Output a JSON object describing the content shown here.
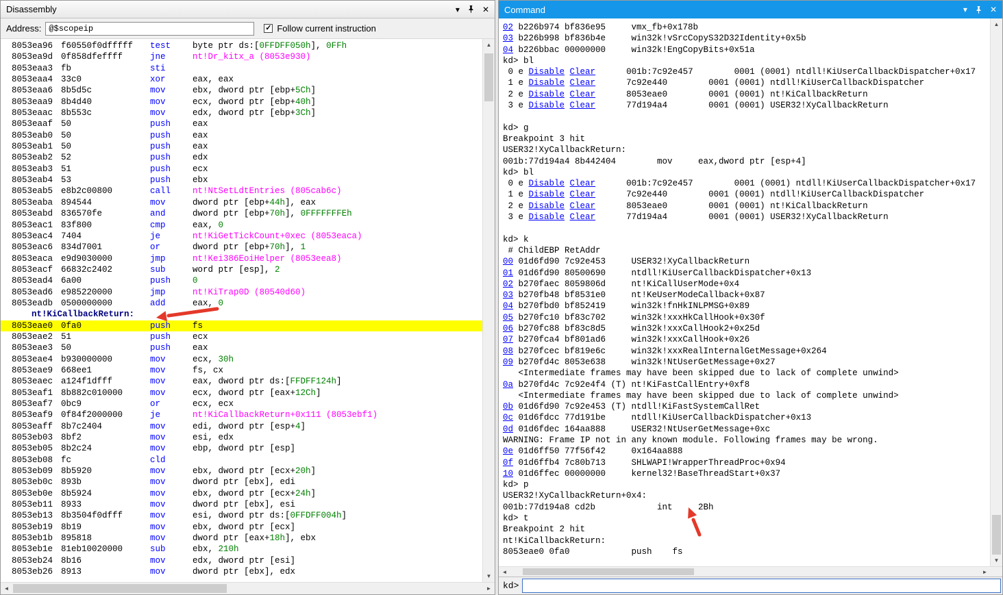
{
  "colors": {
    "command_title_bg": "#1696e8",
    "highlight_bg": "#ffff00",
    "mnemonic": "#0000ff",
    "number_literal": "#008000",
    "symbol_ref": "#ff00ff",
    "link": "#0000ff",
    "label": "#000080",
    "arrow": "#e4392a"
  },
  "icons": {
    "chevron": "▾",
    "close": "✕",
    "scroll_up": "▲",
    "scroll_down": "▼",
    "scroll_left": "◄",
    "scroll_right": "►",
    "check": "✓"
  },
  "disassembly": {
    "title": "Disassembly",
    "address_label": "Address:",
    "address_value": "@$scopeip",
    "follow_label": "Follow current instruction",
    "follow_checked": true,
    "lines": [
      {
        "addr": "8053ea96",
        "bytes": "f60550f0dfffff",
        "mnem": "test",
        "ops": [
          [
            "p",
            "byte ptr ds:["
          ],
          [
            "n",
            "0FFDFF050h"
          ],
          [
            "p",
            "], "
          ],
          [
            "n",
            "0FFh"
          ]
        ]
      },
      {
        "addr": "8053ea9d",
        "bytes": "0f858dfeffff",
        "mnem": "jne",
        "ops": [
          [
            "s",
            "nt!Dr_kitx_a (8053e930)"
          ]
        ]
      },
      {
        "addr": "8053eaa3",
        "bytes": "fb",
        "mnem": "sti",
        "ops": []
      },
      {
        "addr": "8053eaa4",
        "bytes": "33c0",
        "mnem": "xor",
        "ops": [
          [
            "p",
            "eax, eax"
          ]
        ]
      },
      {
        "addr": "8053eaa6",
        "bytes": "8b5d5c",
        "mnem": "mov",
        "ops": [
          [
            "p",
            "ebx, dword ptr [ebp+"
          ],
          [
            "n",
            "5Ch"
          ],
          [
            "p",
            "]"
          ]
        ]
      },
      {
        "addr": "8053eaa9",
        "bytes": "8b4d40",
        "mnem": "mov",
        "ops": [
          [
            "p",
            "ecx, dword ptr [ebp+"
          ],
          [
            "n",
            "40h"
          ],
          [
            "p",
            "]"
          ]
        ]
      },
      {
        "addr": "8053eaac",
        "bytes": "8b553c",
        "mnem": "mov",
        "ops": [
          [
            "p",
            "edx, dword ptr [ebp+"
          ],
          [
            "n",
            "3Ch"
          ],
          [
            "p",
            "]"
          ]
        ]
      },
      {
        "addr": "8053eaaf",
        "bytes": "50",
        "mnem": "push",
        "ops": [
          [
            "p",
            "eax"
          ]
        ]
      },
      {
        "addr": "8053eab0",
        "bytes": "50",
        "mnem": "push",
        "ops": [
          [
            "p",
            "eax"
          ]
        ]
      },
      {
        "addr": "8053eab1",
        "bytes": "50",
        "mnem": "push",
        "ops": [
          [
            "p",
            "eax"
          ]
        ]
      },
      {
        "addr": "8053eab2",
        "bytes": "52",
        "mnem": "push",
        "ops": [
          [
            "p",
            "edx"
          ]
        ]
      },
      {
        "addr": "8053eab3",
        "bytes": "51",
        "mnem": "push",
        "ops": [
          [
            "p",
            "ecx"
          ]
        ]
      },
      {
        "addr": "8053eab4",
        "bytes": "53",
        "mnem": "push",
        "ops": [
          [
            "p",
            "ebx"
          ]
        ]
      },
      {
        "addr": "8053eab5",
        "bytes": "e8b2c00800",
        "mnem": "call",
        "ops": [
          [
            "s",
            "nt!NtSetLdtEntries (805cab6c)"
          ]
        ]
      },
      {
        "addr": "8053eaba",
        "bytes": "894544",
        "mnem": "mov",
        "ops": [
          [
            "p",
            "dword ptr [ebp+"
          ],
          [
            "n",
            "44h"
          ],
          [
            "p",
            "], eax"
          ]
        ]
      },
      {
        "addr": "8053eabd",
        "bytes": "836570fe",
        "mnem": "and",
        "ops": [
          [
            "p",
            "dword ptr [ebp+"
          ],
          [
            "n",
            "70h"
          ],
          [
            "p",
            "], "
          ],
          [
            "n",
            "0FFFFFFFEh"
          ]
        ]
      },
      {
        "addr": "8053eac1",
        "bytes": "83f800",
        "mnem": "cmp",
        "ops": [
          [
            "p",
            "eax, "
          ],
          [
            "n",
            "0"
          ]
        ]
      },
      {
        "addr": "8053eac4",
        "bytes": "7404",
        "mnem": "je",
        "ops": [
          [
            "s",
            "nt!KiGetTickCount+0xec (8053eaca)"
          ]
        ]
      },
      {
        "addr": "8053eac6",
        "bytes": "834d7001",
        "mnem": "or",
        "ops": [
          [
            "p",
            "dword ptr [ebp+"
          ],
          [
            "n",
            "70h"
          ],
          [
            "p",
            "], "
          ],
          [
            "n",
            "1"
          ]
        ]
      },
      {
        "addr": "8053eaca",
        "bytes": "e9d9030000",
        "mnem": "jmp",
        "ops": [
          [
            "s",
            "nt!Kei386EoiHelper (8053eea8)"
          ]
        ]
      },
      {
        "addr": "8053eacf",
        "bytes": "66832c2402",
        "mnem": "sub",
        "ops": [
          [
            "p",
            "word ptr [esp], "
          ],
          [
            "n",
            "2"
          ]
        ]
      },
      {
        "addr": "8053ead4",
        "bytes": "6a00",
        "mnem": "push",
        "ops": [
          [
            "n",
            "0"
          ]
        ]
      },
      {
        "addr": "8053ead6",
        "bytes": "e985220000",
        "mnem": "jmp",
        "ops": [
          [
            "s",
            "nt!KiTrap0D (80540d60)"
          ]
        ]
      },
      {
        "addr": "8053eadb",
        "bytes": "0500000000",
        "mnem": "add",
        "ops": [
          [
            "p",
            "eax, "
          ],
          [
            "n",
            "0"
          ]
        ]
      },
      {
        "label": "nt!KiCallbackReturn:"
      },
      {
        "addr": "8053eae0",
        "bytes": "0fa0",
        "mnem": "push",
        "ops": [
          [
            "p",
            "fs"
          ]
        ],
        "hl": true
      },
      {
        "addr": "8053eae2",
        "bytes": "51",
        "mnem": "push",
        "ops": [
          [
            "p",
            "ecx"
          ]
        ]
      },
      {
        "addr": "8053eae3",
        "bytes": "50",
        "mnem": "push",
        "ops": [
          [
            "p",
            "eax"
          ]
        ]
      },
      {
        "addr": "8053eae4",
        "bytes": "b930000000",
        "mnem": "mov",
        "ops": [
          [
            "p",
            "ecx, "
          ],
          [
            "n",
            "30h"
          ]
        ]
      },
      {
        "addr": "8053eae9",
        "bytes": "668ee1",
        "mnem": "mov",
        "ops": [
          [
            "p",
            "fs, cx"
          ]
        ]
      },
      {
        "addr": "8053eaec",
        "bytes": "a124f1dfff",
        "mnem": "mov",
        "ops": [
          [
            "p",
            "eax, dword ptr ds:["
          ],
          [
            "n",
            "FFDFF124h"
          ],
          [
            "p",
            "]"
          ]
        ]
      },
      {
        "addr": "8053eaf1",
        "bytes": "8b882c010000",
        "mnem": "mov",
        "ops": [
          [
            "p",
            "ecx, dword ptr [eax+"
          ],
          [
            "n",
            "12Ch"
          ],
          [
            "p",
            "]"
          ]
        ]
      },
      {
        "addr": "8053eaf7",
        "bytes": "0bc9",
        "mnem": "or",
        "ops": [
          [
            "p",
            "ecx, ecx"
          ]
        ]
      },
      {
        "addr": "8053eaf9",
        "bytes": "0f84f2000000",
        "mnem": "je",
        "ops": [
          [
            "s",
            "nt!KiCallbackReturn+0x111 (8053ebf1)"
          ]
        ]
      },
      {
        "addr": "8053eaff",
        "bytes": "8b7c2404",
        "mnem": "mov",
        "ops": [
          [
            "p",
            "edi, dword ptr [esp+"
          ],
          [
            "n",
            "4"
          ],
          [
            "p",
            "]"
          ]
        ]
      },
      {
        "addr": "8053eb03",
        "bytes": "8bf2",
        "mnem": "mov",
        "ops": [
          [
            "p",
            "esi, edx"
          ]
        ]
      },
      {
        "addr": "8053eb05",
        "bytes": "8b2c24",
        "mnem": "mov",
        "ops": [
          [
            "p",
            "ebp, dword ptr [esp]"
          ]
        ]
      },
      {
        "addr": "8053eb08",
        "bytes": "fc",
        "mnem": "cld",
        "ops": []
      },
      {
        "addr": "8053eb09",
        "bytes": "8b5920",
        "mnem": "mov",
        "ops": [
          [
            "p",
            "ebx, dword ptr [ecx+"
          ],
          [
            "n",
            "20h"
          ],
          [
            "p",
            "]"
          ]
        ]
      },
      {
        "addr": "8053eb0c",
        "bytes": "893b",
        "mnem": "mov",
        "ops": [
          [
            "p",
            "dword ptr [ebx], edi"
          ]
        ]
      },
      {
        "addr": "8053eb0e",
        "bytes": "8b5924",
        "mnem": "mov",
        "ops": [
          [
            "p",
            "ebx, dword ptr [ecx+"
          ],
          [
            "n",
            "24h"
          ],
          [
            "p",
            "]"
          ]
        ]
      },
      {
        "addr": "8053eb11",
        "bytes": "8933",
        "mnem": "mov",
        "ops": [
          [
            "p",
            "dword ptr [ebx], esi"
          ]
        ]
      },
      {
        "addr": "8053eb13",
        "bytes": "8b3504f0dfff",
        "mnem": "mov",
        "ops": [
          [
            "p",
            "esi, dword ptr ds:["
          ],
          [
            "n",
            "0FFDFF004h"
          ],
          [
            "p",
            "]"
          ]
        ]
      },
      {
        "addr": "8053eb19",
        "bytes": "8b19",
        "mnem": "mov",
        "ops": [
          [
            "p",
            "ebx, dword ptr [ecx]"
          ]
        ]
      },
      {
        "addr": "8053eb1b",
        "bytes": "895818",
        "mnem": "mov",
        "ops": [
          [
            "p",
            "dword ptr [eax+"
          ],
          [
            "n",
            "18h"
          ],
          [
            "p",
            "], ebx"
          ]
        ]
      },
      {
        "addr": "8053eb1e",
        "bytes": "81eb10020000",
        "mnem": "sub",
        "ops": [
          [
            "p",
            "ebx, "
          ],
          [
            "n",
            "210h"
          ]
        ]
      },
      {
        "addr": "8053eb24",
        "bytes": "8b16",
        "mnem": "mov",
        "ops": [
          [
            "p",
            "edx, dword ptr [esi]"
          ]
        ]
      },
      {
        "addr": "8053eb26",
        "bytes": "8913",
        "mnem": "mov",
        "ops": [
          [
            "p",
            "dword ptr [ebx], edx"
          ]
        ]
      }
    ]
  },
  "command": {
    "title": "Command",
    "prompt": "kd>",
    "input_value": "",
    "lines": [
      [
        [
          "l",
          "02"
        ],
        [
          "t",
          " b226b974 bf836e95     vmx_fb+0x178b"
        ]
      ],
      [
        [
          "l",
          "03"
        ],
        [
          "t",
          " b226b998 bf836b4e     win32k!vSrcCopyS32D32Identity+0x5b"
        ]
      ],
      [
        [
          "l",
          "04"
        ],
        [
          "t",
          " b226bbac 00000000     win32k!EngCopyBits+0x51a"
        ]
      ],
      [
        [
          "t",
          "kd> bl"
        ]
      ],
      [
        [
          "t",
          " 0 e "
        ],
        [
          "l",
          "Disable"
        ],
        [
          "t",
          " "
        ],
        [
          "l",
          "Clear"
        ],
        [
          "t",
          "      001b:7c92e457        0001 (0001) ntdll!KiUserCallbackDispatcher+0x17"
        ]
      ],
      [
        [
          "t",
          " 1 e "
        ],
        [
          "l",
          "Disable"
        ],
        [
          "t",
          " "
        ],
        [
          "l",
          "Clear"
        ],
        [
          "t",
          "      7c92e440        0001 (0001) ntdll!KiUserCallbackDispatcher"
        ]
      ],
      [
        [
          "t",
          " 2 e "
        ],
        [
          "l",
          "Disable"
        ],
        [
          "t",
          " "
        ],
        [
          "l",
          "Clear"
        ],
        [
          "t",
          "      8053eae0        0001 (0001) nt!KiCallbackReturn"
        ]
      ],
      [
        [
          "t",
          " 3 e "
        ],
        [
          "l",
          "Disable"
        ],
        [
          "t",
          " "
        ],
        [
          "l",
          "Clear"
        ],
        [
          "t",
          "      77d194a4        0001 (0001) USER32!XyCallbackReturn"
        ]
      ],
      [
        [
          "t",
          ""
        ]
      ],
      [
        [
          "t",
          "kd> g"
        ]
      ],
      [
        [
          "t",
          "Breakpoint 3 hit"
        ]
      ],
      [
        [
          "t",
          "USER32!XyCallbackReturn:"
        ]
      ],
      [
        [
          "t",
          "001b:77d194a4 8b442404        mov     eax,dword ptr [esp+4]"
        ]
      ],
      [
        [
          "t",
          "kd> bl"
        ]
      ],
      [
        [
          "t",
          " 0 e "
        ],
        [
          "l",
          "Disable"
        ],
        [
          "t",
          " "
        ],
        [
          "l",
          "Clear"
        ],
        [
          "t",
          "      001b:7c92e457        0001 (0001) ntdll!KiUserCallbackDispatcher+0x17"
        ]
      ],
      [
        [
          "t",
          " 1 e "
        ],
        [
          "l",
          "Disable"
        ],
        [
          "t",
          " "
        ],
        [
          "l",
          "Clear"
        ],
        [
          "t",
          "      7c92e440        0001 (0001) ntdll!KiUserCallbackDispatcher"
        ]
      ],
      [
        [
          "t",
          " 2 e "
        ],
        [
          "l",
          "Disable"
        ],
        [
          "t",
          " "
        ],
        [
          "l",
          "Clear"
        ],
        [
          "t",
          "      8053eae0        0001 (0001) nt!KiCallbackReturn"
        ]
      ],
      [
        [
          "t",
          " 3 e "
        ],
        [
          "l",
          "Disable"
        ],
        [
          "t",
          " "
        ],
        [
          "l",
          "Clear"
        ],
        [
          "t",
          "      77d194a4        0001 (0001) USER32!XyCallbackReturn"
        ]
      ],
      [
        [
          "t",
          ""
        ]
      ],
      [
        [
          "t",
          "kd> k"
        ]
      ],
      [
        [
          "t",
          " # ChildEBP RetAddr"
        ]
      ],
      [
        [
          "l",
          "00"
        ],
        [
          "t",
          " 01d6fd90 7c92e453     USER32!XyCallbackReturn"
        ]
      ],
      [
        [
          "l",
          "01"
        ],
        [
          "t",
          " 01d6fd90 80500690     ntdll!KiUserCallbackDispatcher+0x13"
        ]
      ],
      [
        [
          "l",
          "02"
        ],
        [
          "t",
          " b270faec 8059806d     nt!KiCallUserMode+0x4"
        ]
      ],
      [
        [
          "l",
          "03"
        ],
        [
          "t",
          " b270fb48 bf8531e0     nt!KeUserModeCallback+0x87"
        ]
      ],
      [
        [
          "l",
          "04"
        ],
        [
          "t",
          " b270fbd0 bf852419     win32k!fnHkINLPMSG+0x89"
        ]
      ],
      [
        [
          "l",
          "05"
        ],
        [
          "t",
          " b270fc10 bf83c702     win32k!xxxHkCallHook+0x30f"
        ]
      ],
      [
        [
          "l",
          "06"
        ],
        [
          "t",
          " b270fc88 bf83c8d5     win32k!xxxCallHook2+0x25d"
        ]
      ],
      [
        [
          "l",
          "07"
        ],
        [
          "t",
          " b270fca4 bf801ad6     win32k!xxxCallHook+0x26"
        ]
      ],
      [
        [
          "l",
          "08"
        ],
        [
          "t",
          " b270fcec bf819e6c     win32k!xxxRealInternalGetMessage+0x264"
        ]
      ],
      [
        [
          "l",
          "09"
        ],
        [
          "t",
          " b270fd4c 8053e638     win32k!NtUserGetMessage+0x27"
        ]
      ],
      [
        [
          "t",
          "   <Intermediate frames may have been skipped due to lack of complete unwind>"
        ]
      ],
      [
        [
          "l",
          "0a"
        ],
        [
          "t",
          " b270fd4c 7c92e4f4 (T) nt!KiFastCallEntry+0xf8"
        ]
      ],
      [
        [
          "t",
          "   <Intermediate frames may have been skipped due to lack of complete unwind>"
        ]
      ],
      [
        [
          "l",
          "0b"
        ],
        [
          "t",
          " 01d6fd90 7c92e453 (T) ntdll!KiFastSystemCallRet"
        ]
      ],
      [
        [
          "l",
          "0c"
        ],
        [
          "t",
          " 01d6fdcc 77d191be     ntdll!KiUserCallbackDispatcher+0x13"
        ]
      ],
      [
        [
          "l",
          "0d"
        ],
        [
          "t",
          " 01d6fdec 164aa888     USER32!NtUserGetMessage+0xc"
        ]
      ],
      [
        [
          "t",
          "WARNING: Frame IP not in any known module. Following frames may be wrong."
        ]
      ],
      [
        [
          "l",
          "0e"
        ],
        [
          "t",
          " 01d6ff50 77f56f42     0x164aa888"
        ]
      ],
      [
        [
          "l",
          "0f"
        ],
        [
          "t",
          " 01d6ffb4 7c80b713     SHLWAPI!WrapperThreadProc+0x94"
        ]
      ],
      [
        [
          "l",
          "10"
        ],
        [
          "t",
          " 01d6ffec 00000000     kernel32!BaseThreadStart+0x37"
        ]
      ],
      [
        [
          "t",
          "kd> p"
        ]
      ],
      [
        [
          "t",
          "USER32!XyCallbackReturn+0x4:"
        ]
      ],
      [
        [
          "t",
          "001b:77d194a8 cd2b            int     2Bh"
        ]
      ],
      [
        [
          "t",
          "kd> t"
        ]
      ],
      [
        [
          "t",
          "Breakpoint 2 hit"
        ]
      ],
      [
        [
          "t",
          "nt!KiCallbackReturn:"
        ]
      ],
      [
        [
          "t",
          "8053eae0 0fa0            push    fs"
        ]
      ]
    ]
  }
}
